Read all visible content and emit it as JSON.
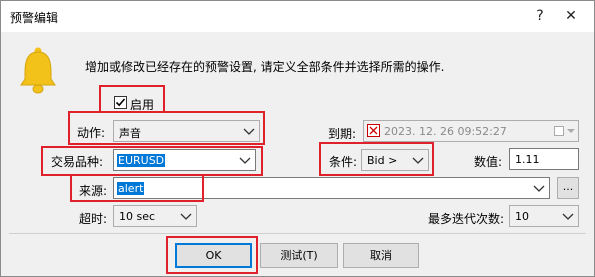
{
  "window": {
    "title": "预警编辑",
    "help_icon": "?",
    "close_icon": "✕"
  },
  "intro": {
    "text": "增加或修改已经存在的预警设置, 请定义全部条件并选择所需的操作."
  },
  "form": {
    "enable": {
      "label": "启用",
      "checked": true
    },
    "action": {
      "label": "动作:",
      "value": "声音"
    },
    "expiry": {
      "label": "到期:",
      "value": "2023. 12. 26 09:52:27",
      "checked": false
    },
    "symbol": {
      "label": "交易品种:",
      "value": "EURUSD"
    },
    "condition": {
      "label": "条件:",
      "value": "Bid >"
    },
    "value": {
      "label": "数值:",
      "value": "1.11"
    },
    "source": {
      "label": "来源:",
      "value": "alert",
      "browse": "..."
    },
    "timeout": {
      "label": "超时:",
      "value": "10 sec"
    },
    "max_iterations": {
      "label": "最多迭代次数:",
      "value": "10"
    }
  },
  "buttons": {
    "ok": "OK",
    "test": "测试(T)",
    "cancel": "取消"
  },
  "colors": {
    "highlight_red": "#e0202a",
    "selection_blue": "#0078d7",
    "bell_yellow": "#f2c21b"
  }
}
